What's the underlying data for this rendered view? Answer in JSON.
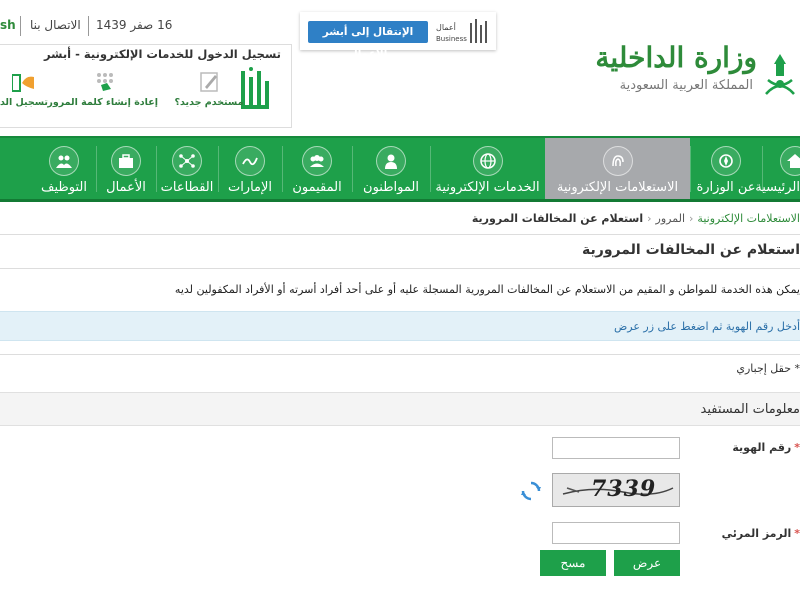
{
  "header": {
    "lang_link": "sh",
    "contact": "الاتصال بنا",
    "date": "16 صفر 1439",
    "business_button": "الإنتقال إلى أبشر الأعمال",
    "business_logo_ar": "أعمال",
    "business_logo_en": "Business",
    "ministry_name": "وزارة الداخلية",
    "kingdom_name": "المملكة العربية السعودية"
  },
  "login_panel": {
    "title": "تسجيل الدخول للخدمات الإلكترونية - أبشر",
    "items": [
      {
        "label": "مستخدم جديد؟"
      },
      {
        "label": "إعادة إنشاء كلمة المرور"
      },
      {
        "label": "تسجيل الدخ"
      }
    ]
  },
  "nav": {
    "items": [
      {
        "label": "الرئيسية"
      },
      {
        "label": "عن الوزارة"
      },
      {
        "label": "الاستعلامات الإلكترونية"
      },
      {
        "label": "الخدمات الإلكترونية"
      },
      {
        "label": "المواطنون"
      },
      {
        "label": "المقيمون"
      },
      {
        "label": "الإمارات"
      },
      {
        "label": "القطاعات"
      },
      {
        "label": "الأعمال"
      },
      {
        "label": "التوظيف"
      }
    ]
  },
  "breadcrumb": {
    "items": [
      "الاستعلامات الإلكترونية",
      "المرور",
      "استعلام عن المخالفات المرورية"
    ]
  },
  "main": {
    "title": "استعلام عن المخالفات المرورية",
    "description": "يمكن هذه الخدمة للمواطن و المقيم من الاستعلام عن المخالفات المرورية المسجلة عليه أو على أحد أفراد أسرته أو الأفراد المكفولين لديه",
    "info": "أدخل رقم الهوية ثم اضغط على زر عرض",
    "required_note": "* حقل إجباري",
    "section_title": "معلومات المستفيد"
  },
  "form": {
    "id_label": "رقم الهوية",
    "id_value": "",
    "captcha_text": "7339",
    "code_label": "الرمز المرئي",
    "code_value": "",
    "submit_label": "عرض",
    "clear_label": "مسح"
  },
  "colors": {
    "brand_green": "#1ea04a",
    "active_tab": "#a7a9ac",
    "info_blue": "#2a6fa8",
    "business_blue": "#2f80c6"
  }
}
